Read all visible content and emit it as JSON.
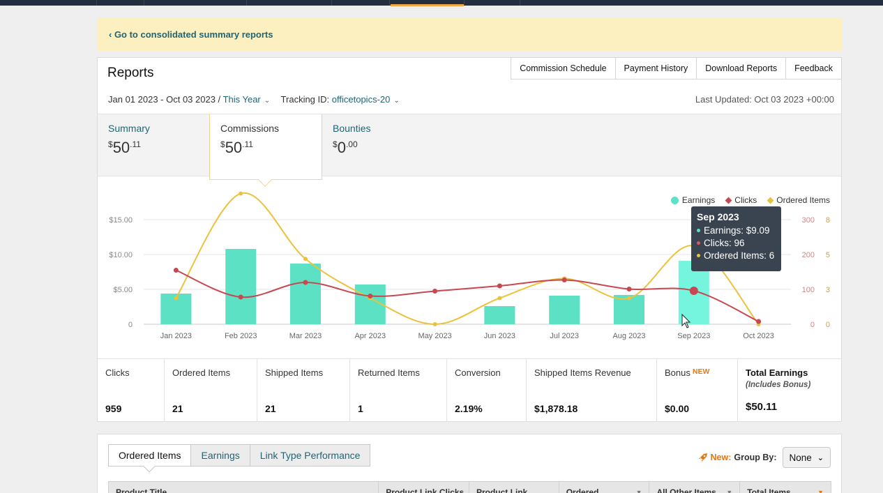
{
  "banner": {
    "link": "‹ Go to consolidated summary reports"
  },
  "header": {
    "title": "Reports",
    "buttons": [
      "Commission Schedule",
      "Payment History",
      "Download Reports",
      "Feedback"
    ],
    "date_range": "Jan 01 2023 - Oct 03 2023 /",
    "date_preset": "This Year",
    "tracking_label": "Tracking ID:",
    "tracking_id": "officetopics-20",
    "last_updated": "Last Updated: Oct 03 2023 +00:00"
  },
  "tabs": [
    {
      "label": "Summary",
      "dollar": "$",
      "whole": "50",
      "cents": ".11"
    },
    {
      "label": "Commissions",
      "dollar": "$",
      "whole": "50",
      "cents": ".11"
    },
    {
      "label": "Bounties",
      "dollar": "$",
      "whole": "0",
      "cents": ".00"
    }
  ],
  "legend": {
    "earnings": "Earnings",
    "clicks": "Clicks",
    "ordered": "Ordered Items"
  },
  "colors": {
    "earnings": "#5ce1c4",
    "earnings_hover": "#76f5de",
    "clicks": "#c9474f",
    "ordered": "#ecc23c",
    "link": "#1f6574",
    "accent": "#e47911"
  },
  "tooltip": {
    "title": "Sep 2023",
    "earnings": "Earnings: $9.09",
    "clicks": "Clicks: 96",
    "ordered": "Ordered Items: 6"
  },
  "chart_data": {
    "type": "bar",
    "categories": [
      "Jan 2023",
      "Feb 2023",
      "Mar 2023",
      "Apr 2023",
      "May 2023",
      "Jun 2023",
      "Jul 2023",
      "Aug 2023",
      "Sep 2023",
      "Oct 2023"
    ],
    "series": [
      {
        "name": "Earnings",
        "type": "bar",
        "axis": "left",
        "values": [
          4.4,
          10.8,
          8.7,
          5.7,
          0,
          2.6,
          4.1,
          4.2,
          9.09,
          0
        ]
      },
      {
        "name": "Clicks",
        "type": "line",
        "axis": "right1",
        "values": [
          155,
          78,
          120,
          81,
          95,
          110,
          127,
          101,
          96,
          8
        ]
      },
      {
        "name": "Ordered Items",
        "type": "line",
        "axis": "right2",
        "values": [
          2,
          10,
          5,
          2,
          0,
          2,
          3.5,
          2,
          6,
          0
        ]
      }
    ],
    "left_axis": {
      "ticks": [
        "0",
        "$5.00",
        "$10.00",
        "$15.00"
      ],
      "range": [
        0,
        15
      ]
    },
    "right1_axis": {
      "ticks": [
        "0",
        "100",
        "200",
        "300"
      ],
      "range": [
        0,
        300
      ]
    },
    "right2_axis": {
      "ticks": [
        "0",
        "3",
        "5",
        "8"
      ],
      "range": [
        0,
        8
      ]
    },
    "highlight_index": 8
  },
  "stats": [
    {
      "label": "Clicks",
      "value": "959"
    },
    {
      "label": "Ordered Items",
      "value": "21"
    },
    {
      "label": "Shipped Items",
      "value": "21"
    },
    {
      "label": "Returned Items",
      "value": "1"
    },
    {
      "label": "Conversion",
      "value": "2.19%"
    },
    {
      "label": "Shipped Items Revenue",
      "value": "$1,878.18"
    },
    {
      "label": "Bonus",
      "badge": "NEW",
      "value": "$0.00"
    },
    {
      "label": "Total Earnings",
      "sub": "(Includes Bonus)",
      "value": "$50.11"
    }
  ],
  "table": {
    "subtabs": [
      "Ordered Items",
      "Earnings",
      "Link Type Performance"
    ],
    "new_label": "New:",
    "group_by_label": "Group By:",
    "group_by_value": "None",
    "columns": [
      "Product Title",
      "Product Link Clicks",
      "Product Link",
      "Ordered",
      "All Other Items",
      "Total Items"
    ]
  }
}
